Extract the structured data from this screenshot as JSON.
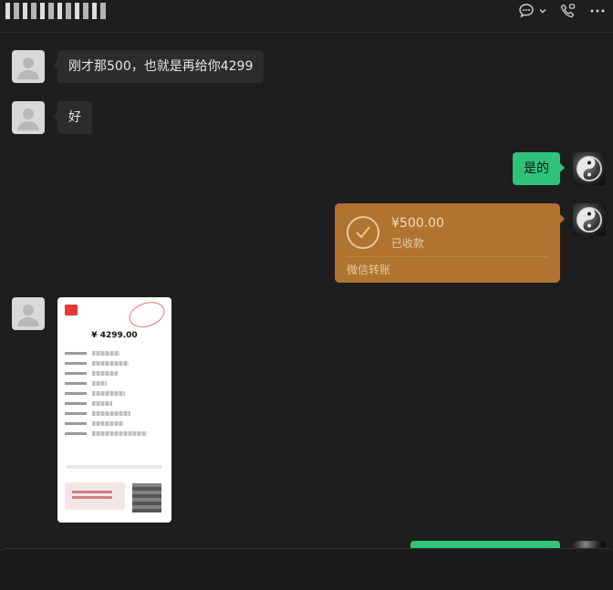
{
  "header": {
    "contact_name": "",
    "icons": [
      "chat-bubble-icon",
      "chevron-down-icon",
      "video-call-icon",
      "more-icon"
    ]
  },
  "messages": [
    {
      "side": "left",
      "type": "text",
      "text": "刚才那500，也就是再给你4299"
    },
    {
      "side": "left",
      "type": "text",
      "text": "好"
    },
    {
      "side": "right",
      "type": "text",
      "text": "是的"
    },
    {
      "side": "right",
      "type": "transfer",
      "amount": "¥500.00",
      "status": "已收款",
      "footer": "微信转账"
    },
    {
      "side": "left",
      "type": "image",
      "receipt_amount": "¥ 4299.00"
    }
  ],
  "colors": {
    "background": "#1e1e1e",
    "bubble_left": "#2c2c2c",
    "bubble_right": "#2fc27a",
    "transfer": "#b07330"
  }
}
